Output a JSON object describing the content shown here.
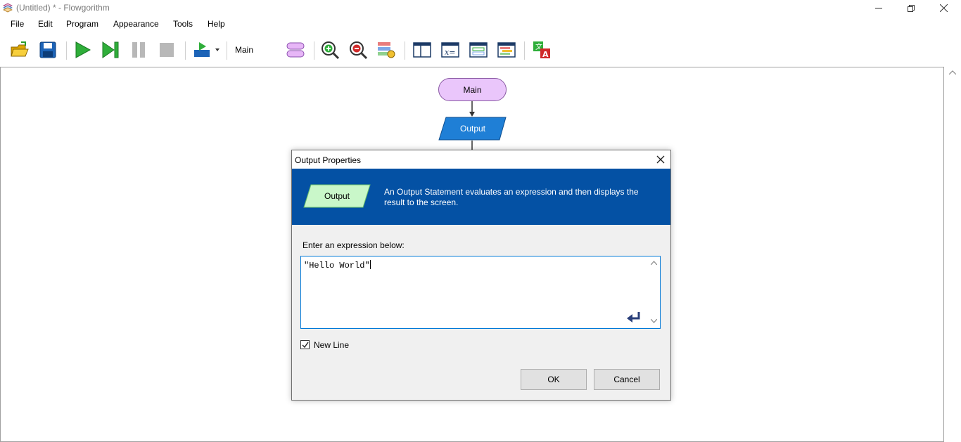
{
  "window": {
    "title": "(Untitled) * - Flowgorithm",
    "icon": "flowgorithm-app-icon",
    "controls": [
      "minimize-icon",
      "restore-icon",
      "close-icon"
    ]
  },
  "menu": {
    "items": [
      "File",
      "Edit",
      "Program",
      "Appearance",
      "Tools",
      "Help"
    ]
  },
  "toolbar": {
    "buttons": [
      "open-folder-icon",
      "save-icon",
      "run-icon",
      "step-icon",
      "pause-icon",
      "stop-icon",
      "run-mode-icon",
      "function-shape-icon",
      "zoom-in-icon",
      "zoom-out-icon",
      "chart-style-icon",
      "layout-window-icon",
      "variable-watch-icon",
      "console-window-icon",
      "source-code-icon",
      "translate-icon"
    ],
    "function_select": "Main"
  },
  "flowchart": {
    "start_node": "Main",
    "output_node": "Output",
    "colors": {
      "main_fill": "#eac6fb",
      "output_fill": "#1f7fd6"
    }
  },
  "dialog": {
    "title": "Output Properties",
    "header_shape_label": "Output",
    "header_description": "An Output Statement evaluates an expression and then displays the result to the screen.",
    "expression_label": "Enter an expression below:",
    "expression_value": "\"Hello World\"",
    "new_line_label": "New Line",
    "new_line_checked": true,
    "ok_label": "OK",
    "cancel_label": "Cancel",
    "colors": {
      "header_bg": "#0451a4",
      "shape_fill": "#c9f7c9"
    }
  }
}
